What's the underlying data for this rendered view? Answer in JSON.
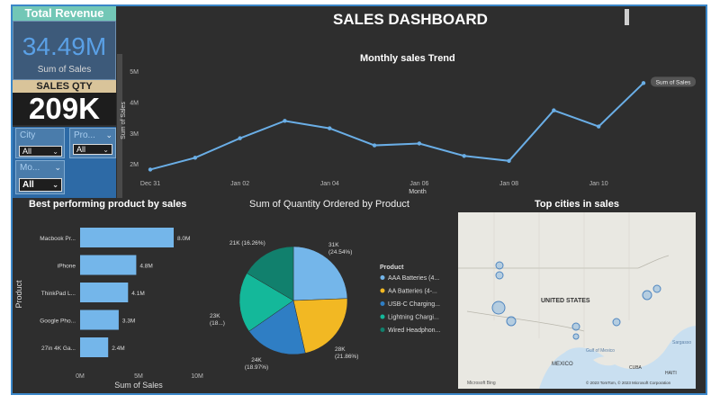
{
  "kpi": {
    "revenue_title": "Total Revenue",
    "revenue_value": "34.49M",
    "revenue_sub": "Sum of Sales",
    "qty_title": "SALES QTY",
    "qty_value": "209K"
  },
  "slicers": {
    "city": {
      "label": "City",
      "value": "All"
    },
    "product": {
      "label": "Pro...",
      "value": "All"
    },
    "month": {
      "label": "Mo...",
      "value": "All"
    }
  },
  "dashboard_title": "SALES DASHBOARD",
  "line": {
    "title": "Monthly sales Trend",
    "ylabel": "Sum of Sales",
    "xlabel": "Month",
    "legend": "Sum of Sales"
  },
  "bar": {
    "title": "Best performing product by sales",
    "xlabel": "Sum of Sales",
    "ylabel": "Product"
  },
  "pie": {
    "title": "Sum of Quantity Ordered by Product",
    "legend_title": "Product"
  },
  "map": {
    "title": "Top cities in sales",
    "country": "UNITED STATES",
    "mexico": "MEXICO",
    "gulf": "Gulf of Mexico",
    "cuba": "CUBA",
    "haiti": "HAITI",
    "sargasso": "Sargasso",
    "bing": "Microsoft Bing",
    "copyright": "© 2023 TomTom, © 2023 Microsoft Corporation"
  },
  "colors": {
    "accent": "#5aa0e6",
    "line": "#6aaee6",
    "bar": "#74b6ea",
    "pie": [
      "#74b6ea",
      "#f2b823",
      "#2f7ec4",
      "#14b89a",
      "#11806d"
    ]
  },
  "chart_data": [
    {
      "type": "line",
      "title": "Monthly sales Trend",
      "xlabel": "Month",
      "ylabel": "Sum of Sales",
      "x": [
        "Dec 31",
        "Jan 01",
        "Jan 02",
        "Jan 03",
        "Jan 04",
        "Jan 05",
        "Jan 06",
        "Jan 07",
        "Jan 08",
        "Jan 09",
        "Jan 10",
        "Jan 11"
      ],
      "x_tick_labels": [
        "Dec 31",
        "Jan 02",
        "Jan 04",
        "Jan 06",
        "Jan 08",
        "Jan 10"
      ],
      "y_tick_labels": [
        "2M",
        "3M",
        "4M",
        "5M"
      ],
      "series": [
        {
          "name": "Sum of Sales",
          "values": [
            1.82,
            2.2,
            2.83,
            3.39,
            3.15,
            2.6,
            2.66,
            2.26,
            2.1,
            3.73,
            3.21,
            4.61
          ]
        }
      ],
      "ylim": [
        1.6,
        5.2
      ],
      "grid": false
    },
    {
      "type": "bar",
      "orientation": "horizontal",
      "title": "Best performing product by sales",
      "xlabel": "Sum of Sales",
      "ylabel": "Product",
      "categories": [
        "Macbook Pr...",
        "iPhone",
        "ThinkPad L...",
        "Google Pho...",
        "27in 4K Ga..."
      ],
      "values": [
        8.0,
        4.8,
        4.1,
        3.3,
        2.4
      ],
      "value_labels": [
        "8.0M",
        "4.8M",
        "4.1M",
        "3.3M",
        "2.4M"
      ],
      "x_tick_labels": [
        "0M",
        "5M",
        "10M"
      ],
      "xlim": [
        0,
        10
      ]
    },
    {
      "type": "pie",
      "title": "Sum of Quantity Ordered by Product",
      "legend_title": "Product",
      "categories": [
        "AAA Batteries (4...",
        "AA Batteries (4-...",
        "USB-C Charging...",
        "Lightning Chargi...",
        "Wired Headphon..."
      ],
      "values": [
        31,
        28,
        24,
        23,
        21
      ],
      "slice_labels": [
        "31K (24.54%)",
        "28K (21.86%)",
        "24K (18.97%)",
        "23K (18...)",
        "21K (16.26%)"
      ],
      "legend": "right"
    }
  ]
}
